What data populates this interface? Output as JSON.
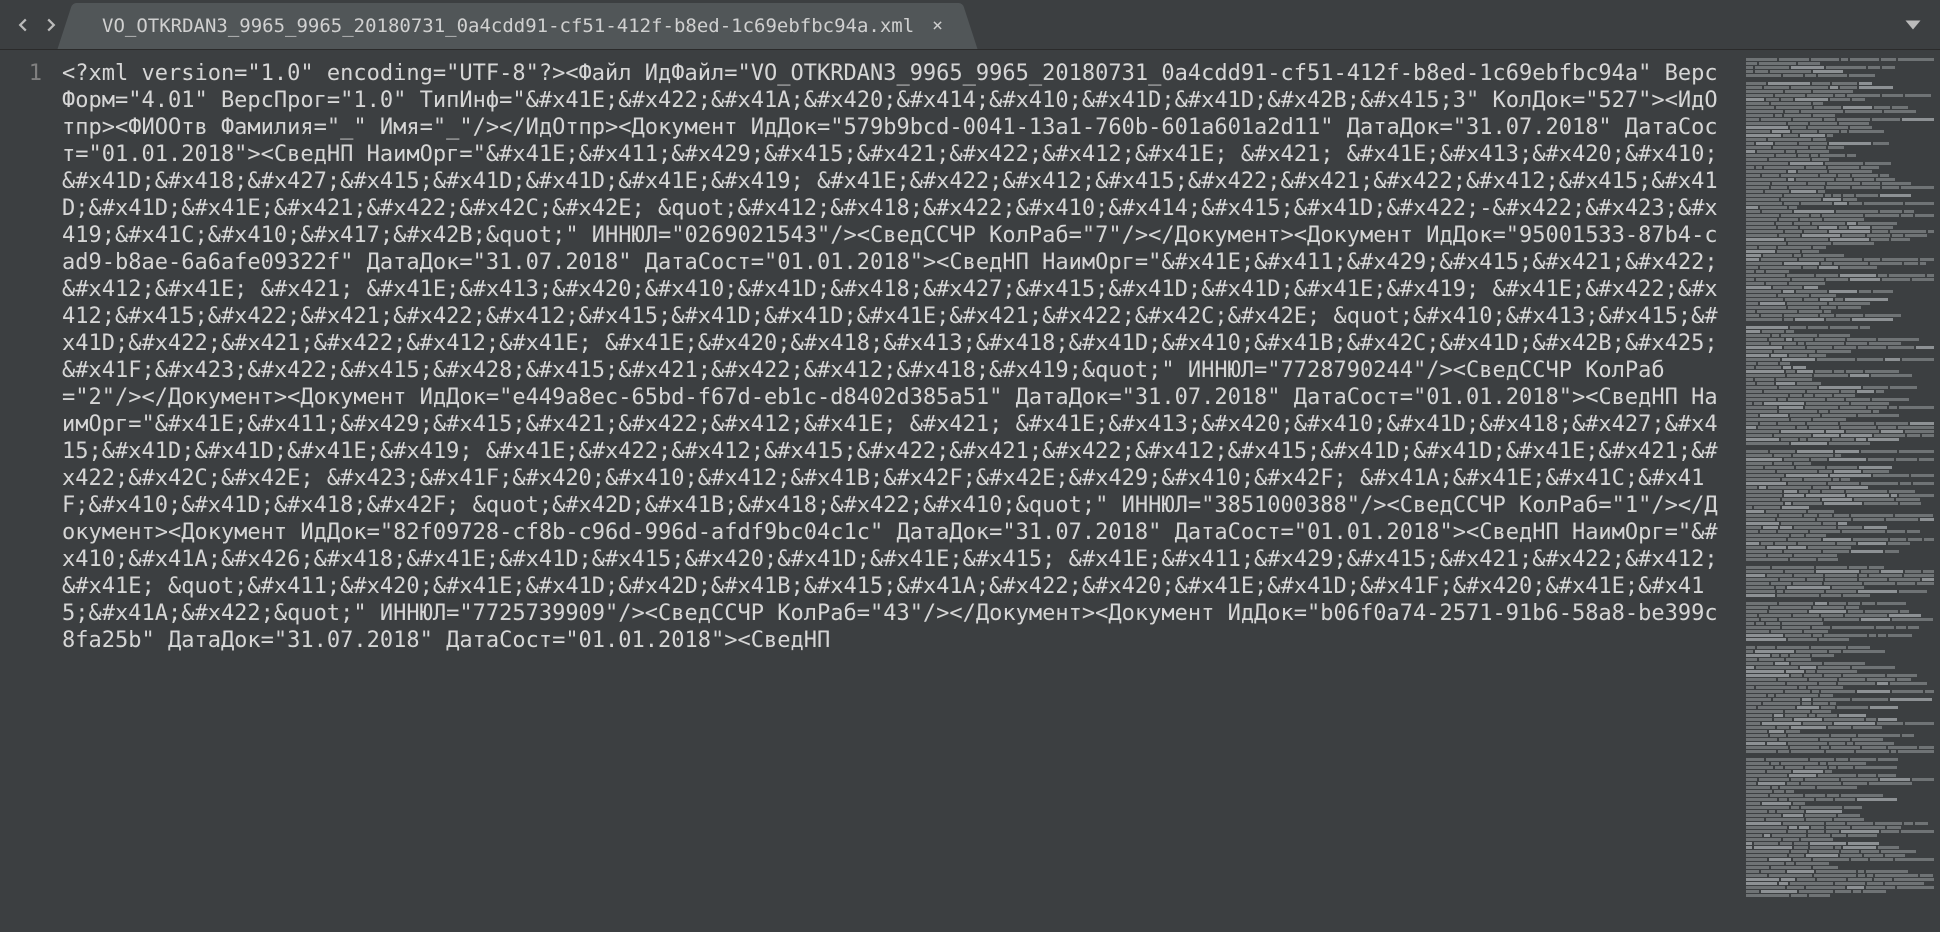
{
  "tab": {
    "filename": "VO_OTKRDAN3_9965_9965_20180731_0a4cdd91-cf51-412f-b8ed-1c69ebfbc94a.xml",
    "close_glyph": "×"
  },
  "gutter": {
    "line1": "1"
  },
  "code": "<?xml version=\"1.0\" encoding=\"UTF-8\"?><Файл ИдФайл=\"VO_OTKRDAN3_9965_9965_20180731_0a4cdd91-cf51-412f-b8ed-1c69ebfbc94a\" ВерсФорм=\"4.01\" ВерсПрог=\"1.0\" ТипИнф=\"&#x41E;&#x422;&#x41A;&#x420;&#x414;&#x410;&#x41D;&#x41D;&#x42B;&#x415;3\" КолДок=\"527\"><ИдОтпр><ФИООтв Фамилия=\"_\" Имя=\"_\"/></ИдОтпр><Документ ИдДок=\"579b9bcd-0041-13a1-760b-601a601a2d11\" ДатаДок=\"31.07.2018\" ДатаСост=\"01.01.2018\"><СведНП НаимОрг=\"&#x41E;&#x411;&#x429;&#x415;&#x421;&#x422;&#x412;&#x41E; &#x421; &#x41E;&#x413;&#x420;&#x410;&#x41D;&#x418;&#x427;&#x415;&#x41D;&#x41D;&#x41E;&#x419; &#x41E;&#x422;&#x412;&#x415;&#x422;&#x421;&#x422;&#x412;&#x415;&#x41D;&#x41D;&#x41E;&#x421;&#x422;&#x42C;&#x42E; &quot;&#x412;&#x418;&#x422;&#x410;&#x414;&#x415;&#x41D;&#x422;-&#x422;&#x423;&#x419;&#x41C;&#x410;&#x417;&#x42B;&quot;\" ИННЮЛ=\"0269021543\"/><СведССЧР КолРаб=\"7\"/></Документ><Документ ИдДок=\"95001533-87b4-cad9-b8ae-6a6afe09322f\" ДатаДок=\"31.07.2018\" ДатаСост=\"01.01.2018\"><СведНП НаимОрг=\"&#x41E;&#x411;&#x429;&#x415;&#x421;&#x422;&#x412;&#x41E; &#x421; &#x41E;&#x413;&#x420;&#x410;&#x41D;&#x418;&#x427;&#x415;&#x41D;&#x41D;&#x41E;&#x419; &#x41E;&#x422;&#x412;&#x415;&#x422;&#x421;&#x422;&#x412;&#x415;&#x41D;&#x41D;&#x41E;&#x421;&#x422;&#x42C;&#x42E; &quot;&#x410;&#x413;&#x415;&#x41D;&#x422;&#x421;&#x422;&#x412;&#x41E; &#x41E;&#x420;&#x418;&#x413;&#x418;&#x41D;&#x410;&#x41B;&#x42C;&#x41D;&#x42B;&#x425; &#x41F;&#x423;&#x422;&#x415;&#x428;&#x415;&#x421;&#x422;&#x412;&#x418;&#x419;&quot;\" ИННЮЛ=\"7728790244\"/><СведССЧР КолРаб=\"2\"/></Документ><Документ ИдДок=\"e449a8ec-65bd-f67d-eb1c-d8402d385a51\" ДатаДок=\"31.07.2018\" ДатаСост=\"01.01.2018\"><СведНП НаимОрг=\"&#x41E;&#x411;&#x429;&#x415;&#x421;&#x422;&#x412;&#x41E; &#x421; &#x41E;&#x413;&#x420;&#x410;&#x41D;&#x418;&#x427;&#x415;&#x41D;&#x41D;&#x41E;&#x419; &#x41E;&#x422;&#x412;&#x415;&#x422;&#x421;&#x422;&#x412;&#x415;&#x41D;&#x41D;&#x41E;&#x421;&#x422;&#x42C;&#x42E; &#x423;&#x41F;&#x420;&#x410;&#x412;&#x41B;&#x42F;&#x42E;&#x429;&#x410;&#x42F; &#x41A;&#x41E;&#x41C;&#x41F;&#x410;&#x41D;&#x418;&#x42F; &quot;&#x42D;&#x41B;&#x418;&#x422;&#x410;&quot;\" ИННЮЛ=\"3851000388\"/><СведССЧР КолРаб=\"1\"/></Документ><Документ ИдДок=\"82f09728-cf8b-c96d-996d-afdf9bc04c1c\" ДатаДок=\"31.07.2018\" ДатаСост=\"01.01.2018\"><СведНП НаимОрг=\"&#x410;&#x41A;&#x426;&#x418;&#x41E;&#x41D;&#x415;&#x420;&#x41D;&#x41E;&#x415; &#x41E;&#x411;&#x429;&#x415;&#x421;&#x422;&#x412;&#x41E; &quot;&#x411;&#x420;&#x41E;&#x41D;&#x42D;&#x41B;&#x415;&#x41A;&#x422;&#x420;&#x41E;&#x41D;&#x41F;&#x420;&#x41E;&#x415;&#x41A;&#x422;&quot;\" ИННЮЛ=\"7725739909\"/><СведССЧР КолРаб=\"43\"/></Документ><Документ ИдДок=\"b06f0a74-2571-91b6-58a8-be399c8fa25b\" ДатаДок=\"31.07.2018\" ДатаСост=\"01.01.2018\"><СведНП"
}
